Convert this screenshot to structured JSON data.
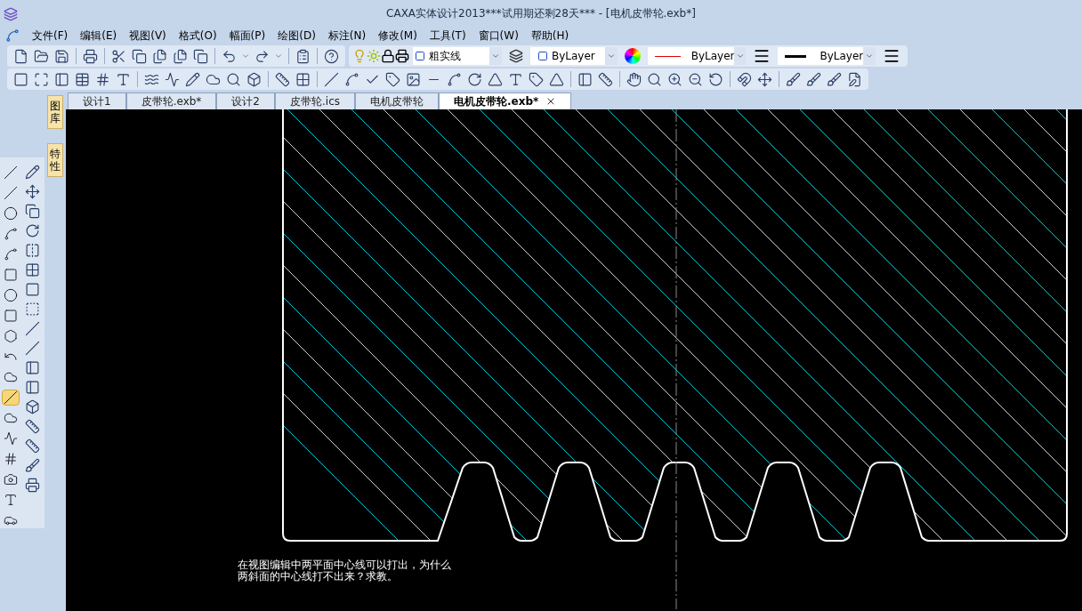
{
  "window": {
    "title": "CAXA实体设计2013***试用期还剩28天*** - [电机皮带轮.exb*]"
  },
  "menu": [
    "文件(F)",
    "编辑(E)",
    "视图(V)",
    "格式(O)",
    "幅面(P)",
    "绘图(D)",
    "标注(N)",
    "修改(M)",
    "工具(T)",
    "窗口(W)",
    "帮助(H)"
  ],
  "properties_toolbar": {
    "layer": "粗实线",
    "color_setting": "ByLayer",
    "line_type": "ByLayer",
    "line_weight": "ByLayer"
  },
  "tabs": [
    {
      "label": "设计1",
      "selected": false
    },
    {
      "label": "皮带轮.exb*",
      "selected": false
    },
    {
      "label": "设计2",
      "selected": false
    },
    {
      "label": "皮带轮.ics",
      "selected": false
    },
    {
      "label": "电机皮带轮",
      "selected": false
    },
    {
      "label": "电机皮带轮.exb*",
      "selected": true
    }
  ],
  "side_tabs": [
    {
      "label": "图库"
    },
    {
      "label": "特性"
    }
  ],
  "draw_tools": [
    {
      "selected": false
    },
    {
      "selected": false
    },
    {
      "selected": false
    },
    {
      "selected": false
    },
    {
      "selected": false
    },
    {
      "selected": false
    },
    {
      "selected": false
    },
    {
      "selected": false
    },
    {
      "selected": false
    },
    {
      "selected": false
    },
    {
      "selected": false
    },
    {
      "selected": true
    },
    {
      "selected": false
    },
    {
      "selected": false
    },
    {
      "selected": false
    },
    {
      "selected": false
    },
    {
      "selected": false
    },
    {
      "selected": false
    }
  ],
  "canvas": {
    "note_lines": [
      "在视图编辑中两平面中心线可以打出，为什么",
      "两斜面的中心线打不出来？求教。"
    ]
  }
}
